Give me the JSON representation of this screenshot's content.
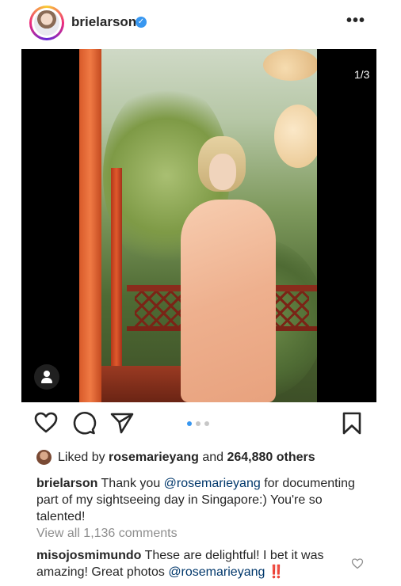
{
  "post": {
    "username": "brielarson",
    "verified_mark": "✓",
    "more_menu": "•••",
    "image_counter": "1/3",
    "likes": {
      "prefix": "Liked by ",
      "user": "rosemarieyang",
      "middle": " and ",
      "count": "264,880 others"
    },
    "caption": {
      "author": "brielarson",
      "text_before": " Thank you ",
      "mention": "@rosemarieyang",
      "text_after": " for documenting part of my sightseeing day in Singapore:) You're so talented!"
    },
    "view_all_comments": "View all 1,136 comments",
    "comment": {
      "author": "misojosmimundo",
      "text": " These are delightful! I bet it was amazing! Great photos ",
      "mention": "@rosemarieyang",
      "emoji": " ‼️"
    },
    "carousel": {
      "total": 3,
      "active_index": 1
    }
  },
  "icons": {
    "like": "heart-icon",
    "comment": "comment-bubble-icon",
    "share": "paper-plane-icon",
    "save": "bookmark-icon",
    "tag": "user-tag-icon",
    "comment_like": "small-heart-icon"
  },
  "colors": {
    "text": "#262626",
    "secondary": "#8e8e8e",
    "link": "#00376b",
    "verified": "#3897f0",
    "carousel_active": "#3897f0",
    "carousel_inactive": "#c7c7c7"
  }
}
